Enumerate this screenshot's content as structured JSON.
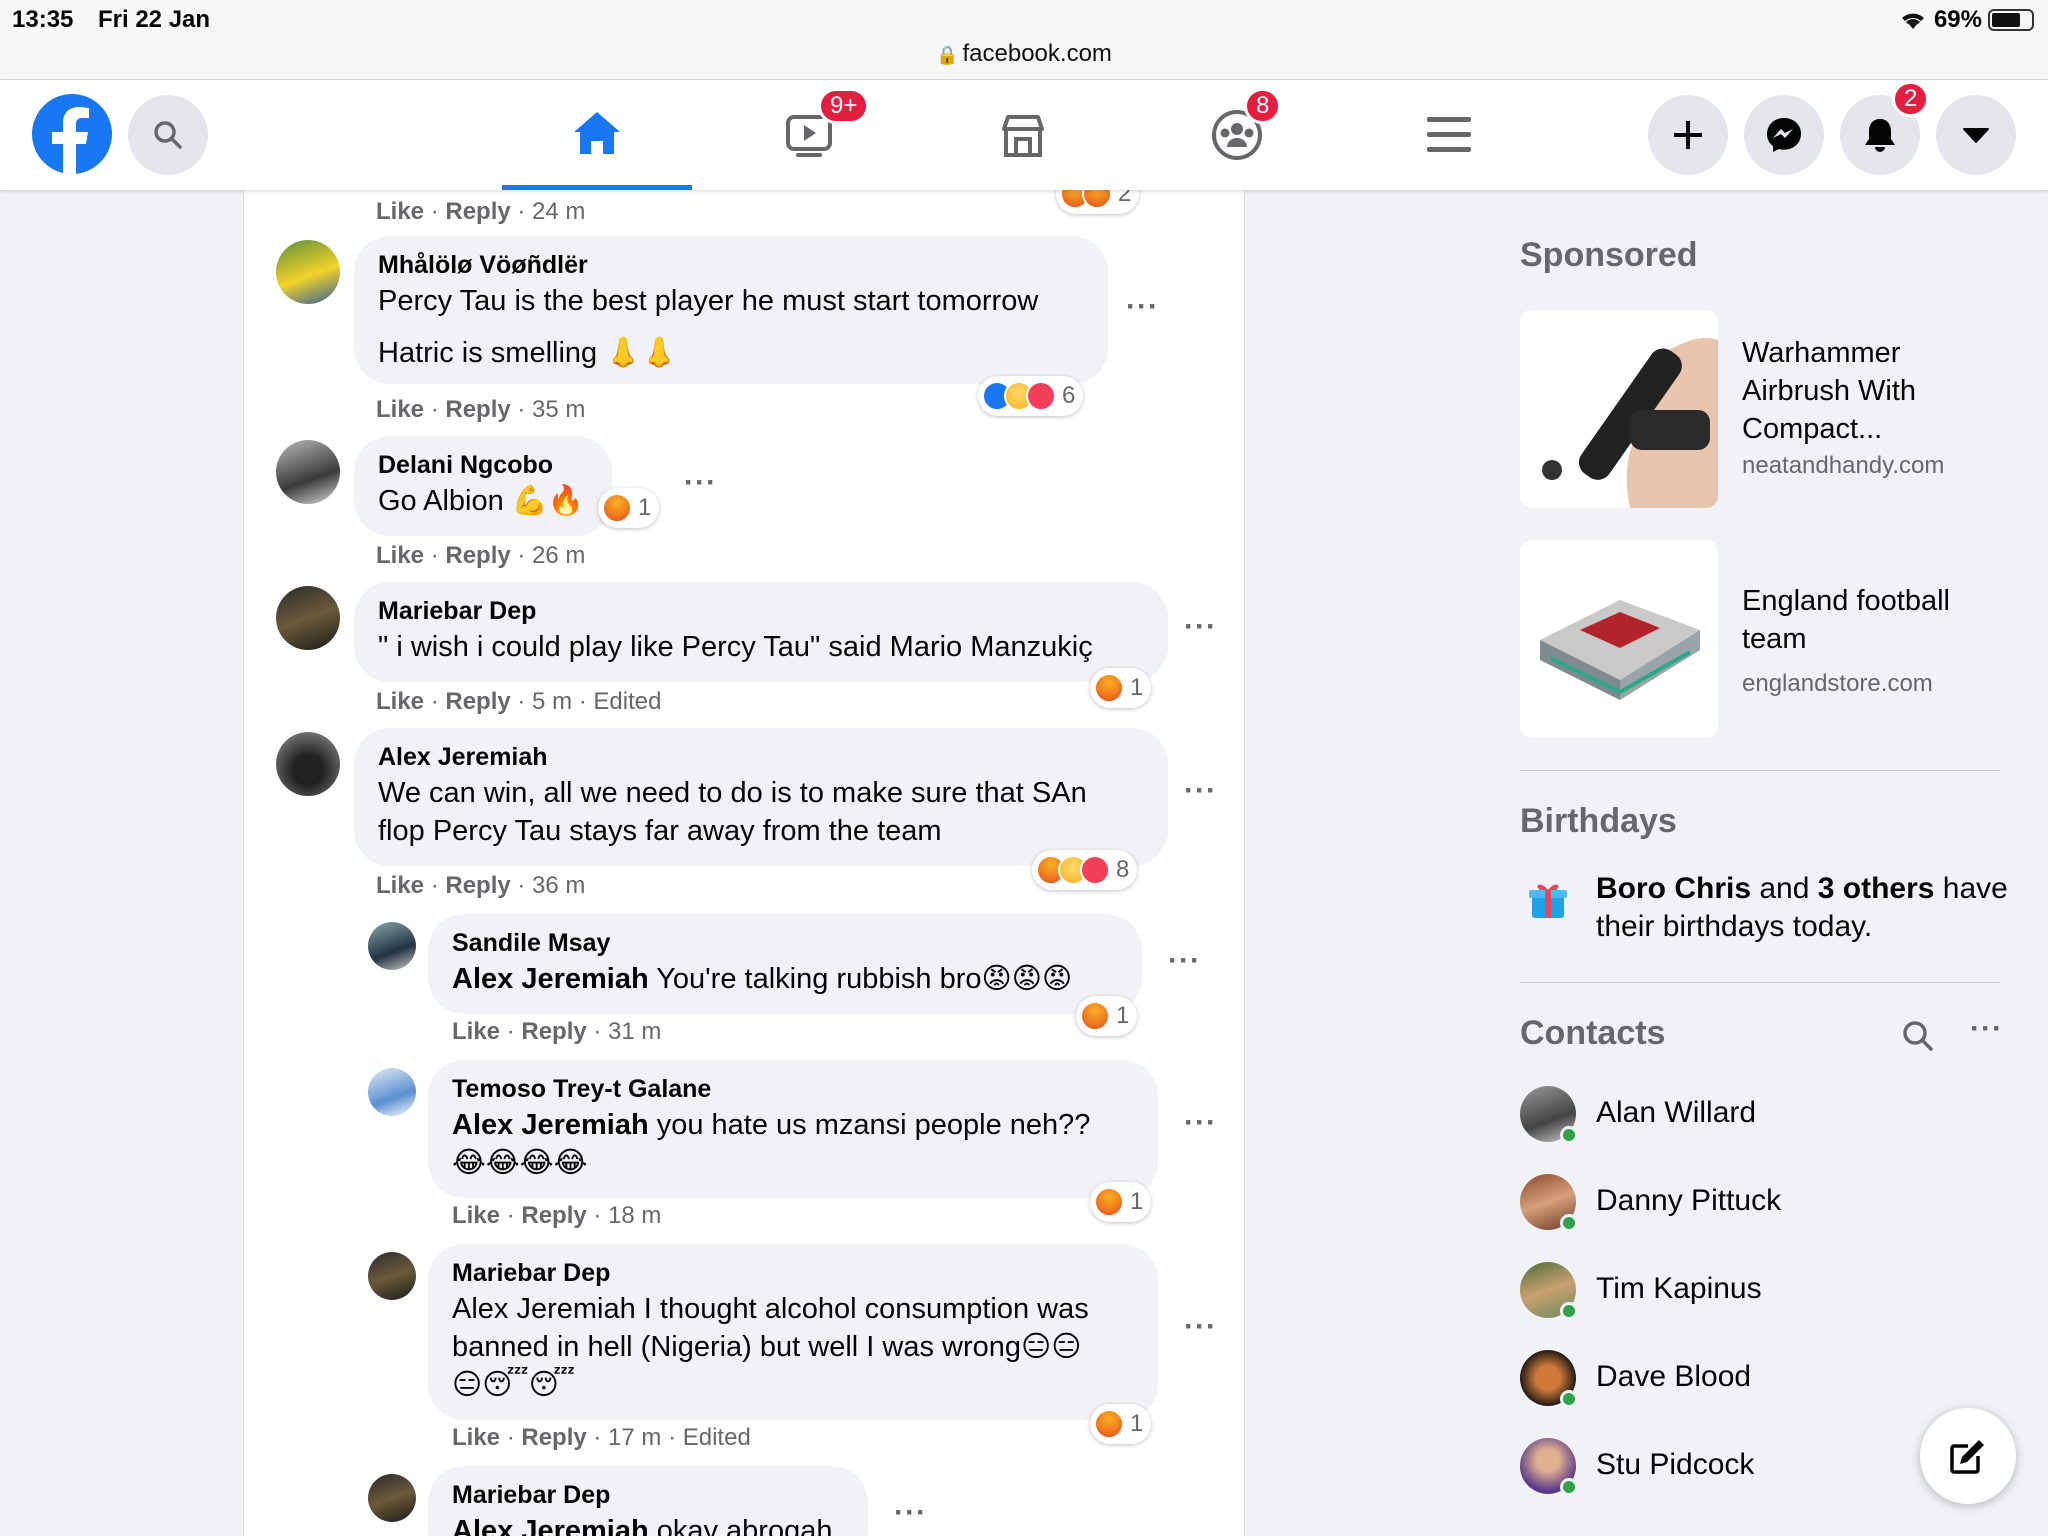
{
  "status_bar": {
    "time": "13:35",
    "date": "Fri 22 Jan",
    "url": "facebook.com",
    "battery": "69%"
  },
  "nav": {
    "watch_badge": "9+",
    "groups_badge": "8",
    "notifications_badge": "2"
  },
  "colors": {
    "brand": "#1877f2",
    "badge": "#e41e3f",
    "online": "#31a24c"
  },
  "comments": [
    {
      "meta_like": "Like",
      "meta_reply": "Reply",
      "meta_time": "· 24 m",
      "reaction_count": "2"
    },
    {
      "author": "Mhålölø Vöøñdlër",
      "line1": "Percy Tau is the best player he must start tomorrow",
      "line2": "Hatric is smelling",
      "meta_like": "Like",
      "meta_reply": "Reply",
      "meta_time": "· 35 m",
      "reaction_count": "6"
    },
    {
      "author": "Delani Ngcobo",
      "line1": "Go Albion",
      "meta_like": "Like",
      "meta_reply": "Reply",
      "meta_time": "· 26 m",
      "reaction_count": "1"
    },
    {
      "author": "Mariebar Dep",
      "line1": "\" i wish i could play like Percy Tau\" said Mario Manzukiç",
      "meta_like": "Like",
      "meta_reply": "Reply",
      "meta_time": "· 5 m · Edited",
      "reaction_count": "1"
    },
    {
      "author": "Alex Jeremiah",
      "line1": "We can win, all we need to do is to make sure that SAn",
      "line2": "flop Percy Tau stays far away from the team",
      "meta_like": "Like",
      "meta_reply": "Reply",
      "meta_time": "· 36 m",
      "reaction_count": "8"
    },
    {
      "author": "Sandile Msay",
      "mention": "Alex Jeremiah",
      "line1": " You're talking rubbish bro",
      "meta_like": "Like",
      "meta_reply": "Reply",
      "meta_time": "· 31 m",
      "reaction_count": "1"
    },
    {
      "author": "Temoso Trey-t Galane",
      "mention": "Alex Jeremiah",
      "line1": " you hate us mzansi people neh??",
      "meta_like": "Like",
      "meta_reply": "Reply",
      "meta_time": "· 18 m",
      "reaction_count": "1"
    },
    {
      "author": "Mariebar Dep",
      "line1": "Alex Jeremiah I thought alcohol consumption was",
      "line2": "banned in hell (Nigeria) but well I was wrong",
      "meta_like": "Like",
      "meta_reply": "Reply",
      "meta_time": "· 17 m · Edited",
      "reaction_count": "1"
    },
    {
      "author": "Mariebar Dep",
      "mention": "Alex Jeremiah",
      "line1": " okay abrogah"
    }
  ],
  "sidebar": {
    "sponsored_title": "Sponsored",
    "ads": [
      {
        "title": "Warhammer Airbrush With Compact...",
        "site": "neatandhandy.com"
      },
      {
        "title": "England football team",
        "site": "englandstore.com"
      }
    ],
    "birthdays_title": "Birthdays",
    "birthday_name": "Boro Chris",
    "birthday_and": " and ",
    "birthday_others": "3 others",
    "birthday_rest": " have their birthdays today.",
    "contacts_title": "Contacts",
    "contacts": [
      "Alan Willard",
      "Danny Pittuck",
      "Tim Kapinus",
      "Dave Blood",
      "Stu Pidcock"
    ]
  }
}
